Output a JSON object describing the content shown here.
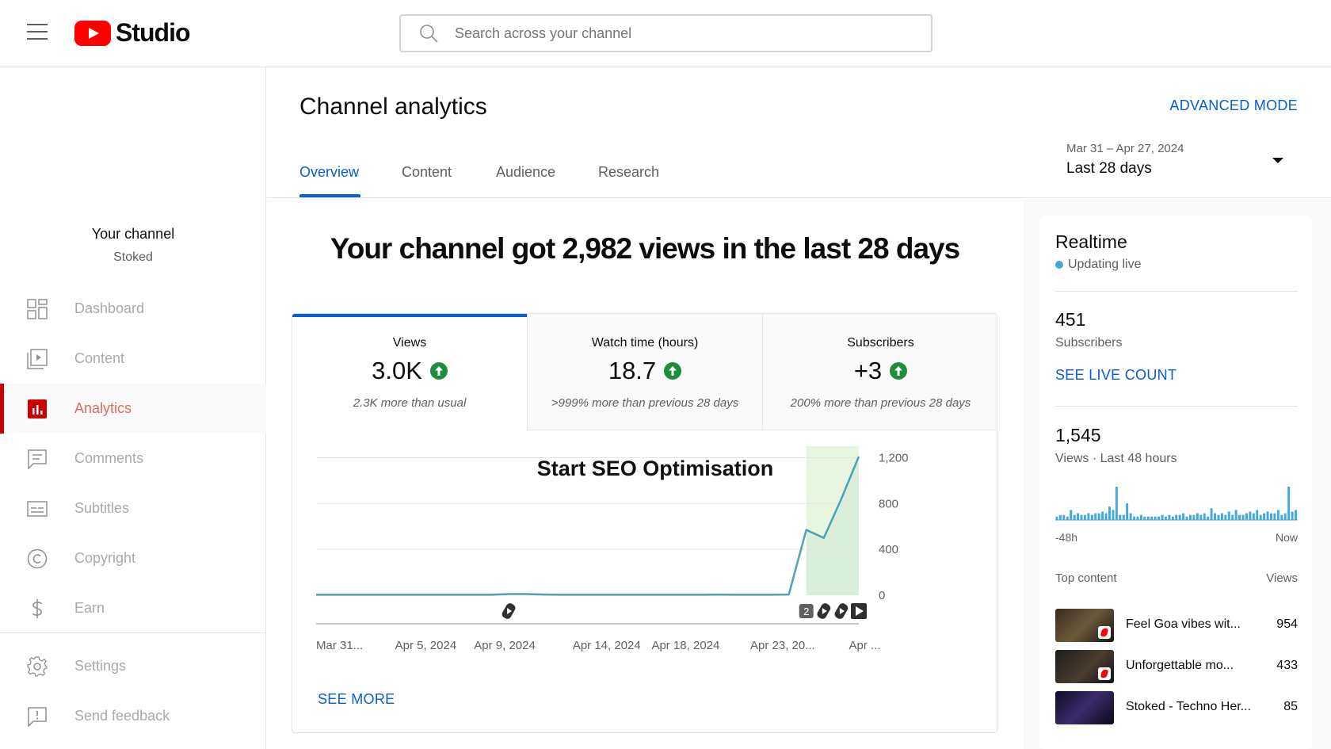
{
  "app": {
    "logo_text": "Studio"
  },
  "search": {
    "placeholder": "Search across your channel"
  },
  "sidebar": {
    "channel_title": "Your channel",
    "channel_name": "Stoked",
    "items": [
      {
        "label": "Dashboard",
        "icon": "dashboard-icon"
      },
      {
        "label": "Content",
        "icon": "content-icon"
      },
      {
        "label": "Analytics",
        "icon": "analytics-icon",
        "active": true
      },
      {
        "label": "Comments",
        "icon": "comments-icon"
      },
      {
        "label": "Subtitles",
        "icon": "subtitles-icon"
      },
      {
        "label": "Copyright",
        "icon": "copyright-icon"
      },
      {
        "label": "Earn",
        "icon": "earn-icon"
      }
    ],
    "bottom_items": [
      {
        "label": "Settings",
        "icon": "gear-icon"
      },
      {
        "label": "Send feedback",
        "icon": "feedback-icon"
      }
    ]
  },
  "header": {
    "title": "Channel analytics",
    "advanced_mode": "ADVANCED MODE",
    "tabs": [
      "Overview",
      "Content",
      "Audience",
      "Research"
    ],
    "active_tab": "Overview",
    "date_range": "Mar 31 – Apr 27, 2024",
    "date_preset": "Last 28 days"
  },
  "overview": {
    "headline": "Your channel got 2,982 views in the last 28 days",
    "metrics": [
      {
        "label": "Views",
        "value": "3.0K",
        "desc": "2.3K more than usual",
        "trend": "up",
        "selected": true
      },
      {
        "label": "Watch time (hours)",
        "value": "18.7",
        "desc": ">999% more than previous 28 days",
        "trend": "up"
      },
      {
        "label": "Subscribers",
        "value": "+3",
        "desc": "200% more than previous 28 days",
        "trend": "up"
      }
    ],
    "see_more": "SEE MORE"
  },
  "chart_data": {
    "type": "line",
    "annotation": "Start SEO Optimisation",
    "x_tick_labels": [
      "Mar 31...",
      "Apr 5, 2024",
      "Apr 9, 2024",
      "Apr 14, 2024",
      "Apr 18, 2024",
      "Apr 23, 20...",
      "Apr ..."
    ],
    "x_days": [
      1,
      2,
      3,
      4,
      5,
      6,
      7,
      8,
      9,
      10,
      11,
      12,
      13,
      14,
      15,
      16,
      17,
      18,
      19,
      20,
      21,
      22,
      23,
      24,
      25,
      26,
      27,
      28
    ],
    "values": [
      4,
      4,
      4,
      4,
      4,
      4,
      4,
      4,
      4,
      4,
      4,
      10,
      10,
      6,
      4,
      4,
      4,
      4,
      4,
      4,
      4,
      4,
      4,
      6,
      4,
      4,
      4,
      6,
      570,
      500,
      840,
      1210
    ],
    "y_ticks": [
      0,
      400,
      800,
      1200
    ],
    "ylim": [
      0,
      1300
    ],
    "highlight_start_index": 28,
    "grid": true,
    "markers": [
      {
        "index": 11,
        "type": "shorts"
      },
      {
        "index": 28,
        "type": "count",
        "label": "2"
      },
      {
        "index": 29,
        "type": "shorts"
      },
      {
        "index": 30,
        "type": "shorts"
      },
      {
        "index": 31,
        "type": "video"
      }
    ],
    "line_color": "#4ba3b8",
    "highlight_color": "#e8f5e0"
  },
  "realtime": {
    "title": "Realtime",
    "status": "Updating live",
    "subscribers_count": "451",
    "subscribers_label": "Subscribers",
    "live_count_link": "SEE LIVE COUNT",
    "views_count": "1,545",
    "views_label": "Views · Last 48 hours",
    "spark_values": [
      2,
      3,
      3,
      2,
      6,
      3,
      4,
      3,
      3,
      4,
      3,
      4,
      4,
      5,
      4,
      8,
      6,
      20,
      3,
      3,
      10,
      4,
      2,
      2,
      3,
      2,
      2,
      2,
      2,
      2,
      3,
      2,
      3,
      2,
      3,
      3,
      4,
      2,
      3,
      3,
      4,
      3,
      4,
      2,
      7,
      4,
      3,
      4,
      3,
      5,
      3,
      6,
      3,
      3,
      4,
      5,
      4,
      6,
      3,
      4,
      5,
      4,
      4,
      6,
      3,
      4,
      20,
      5,
      6
    ],
    "spark_left": "-48h",
    "spark_right": "Now",
    "top_content_label": "Top content",
    "top_content_views_label": "Views",
    "top_content": [
      {
        "title": "Feel Goa vibes wit...",
        "views": "954",
        "shorts": true
      },
      {
        "title": "Unforgettable mo...",
        "views": "433",
        "shorts": true
      },
      {
        "title": "Stoked - Techno Her...",
        "views": "85",
        "shorts": false
      }
    ]
  },
  "colors": {
    "accent": "#065fd4",
    "brand": "#ff0000",
    "trend_up": "#1e8e3e"
  }
}
